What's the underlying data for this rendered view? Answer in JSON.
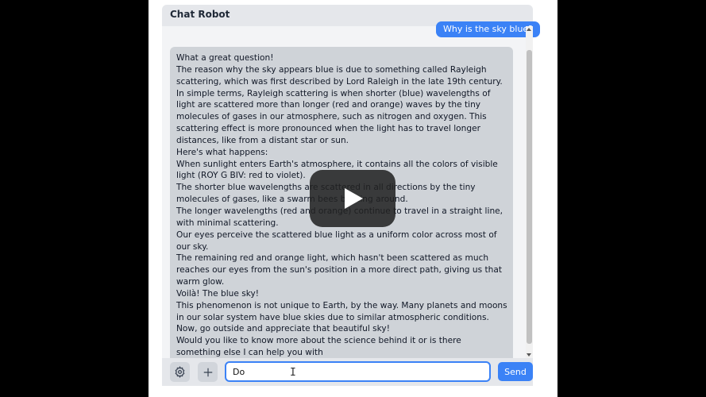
{
  "header": {
    "title": "Chat Robot"
  },
  "messages": {
    "user": "Why is the sky blue?",
    "bot_lines": [
      "What a great question!",
      "The reason why the sky appears blue is due to something called Rayleigh scattering, which was first described by Lord Raleigh in the late 19th century.",
      "In simple terms, Rayleigh scattering is when shorter (blue) wavelengths of light are scattered more than longer (red and orange) waves by the tiny molecules of gases in our atmosphere, such as nitrogen and oxygen. This scattering effect is more pronounced when the light has to travel longer distances, like from a distant star or sun.",
      "Here's what happens:",
      "When sunlight enters Earth's atmosphere, it contains all the colors of visible light (ROY G BIV: red to violet).",
      "The shorter blue wavelengths are scattered in all directions by the tiny molecules of gases, like a swarm bees buzzing around.",
      "The longer wavelengths (red and orange) continue to travel in a straight line, with minimal scattering.",
      "Our eyes perceive the scattered blue light as a uniform color across most of our sky.",
      "The remaining red and orange light, which hasn't been scattered as much reaches our eyes from the sun's position in a more direct path, giving us that warm glow.",
      "Voilà! The blue sky!",
      "This phenomenon is not unique to Earth, by the way. Many planets and moons in our solar system have blue skies due to similar atmospheric conditions.",
      "Now, go outside and appreciate that beautiful sky!",
      "Would you like to know more about the science behind it or is there something else I can help you with"
    ]
  },
  "input": {
    "value": "Do",
    "send_label": "Send"
  },
  "icons": {
    "settings": "gear-icon",
    "add": "plus-icon",
    "play": "play-icon",
    "cursor": "text-cursor-icon"
  },
  "colors": {
    "accent": "#3b82f6",
    "bot_bubble": "#cfd3d8",
    "header": "#e5e7eb"
  }
}
